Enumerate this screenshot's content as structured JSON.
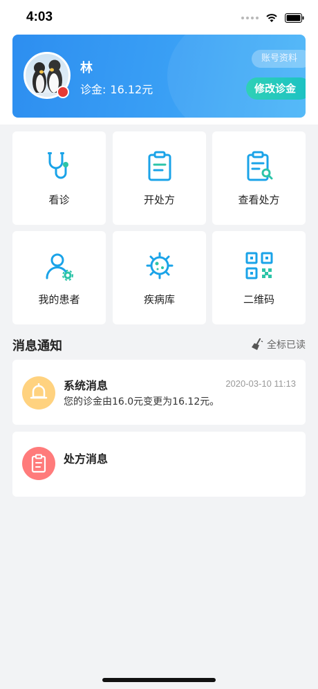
{
  "status_bar": {
    "time": "4:03"
  },
  "profile": {
    "name": "林",
    "fee_label": "诊金:",
    "fee_value": "16.12元",
    "account_button": "账号资料",
    "edit_fee_button": "修改诊金"
  },
  "menu": [
    {
      "label": "看诊",
      "icon": "stethoscope-icon"
    },
    {
      "label": "开处方",
      "icon": "clipboard-icon"
    },
    {
      "label": "查看处方",
      "icon": "clipboard-search-icon"
    },
    {
      "label": "我的患者",
      "icon": "patient-icon"
    },
    {
      "label": "疾病库",
      "icon": "virus-icon"
    },
    {
      "label": "二维码",
      "icon": "qr-code-icon"
    }
  ],
  "notifications": {
    "title": "消息通知",
    "mark_all_read": "全标已读",
    "items": [
      {
        "title": "系统消息",
        "time": "2020-03-10 11:13",
        "body": "您的诊金由16.0元变更为16.12元。",
        "icon": "bell-icon",
        "color": "#ffd27f"
      },
      {
        "title": "处方消息",
        "icon": "clipboard-icon",
        "color": "#ff7b7b"
      }
    ]
  },
  "colors": {
    "accent": "#2d8ef0",
    "teal_button": "#1bc1c4",
    "icon_blue": "#1aa3e8",
    "icon_teal": "#2cc4a8"
  }
}
